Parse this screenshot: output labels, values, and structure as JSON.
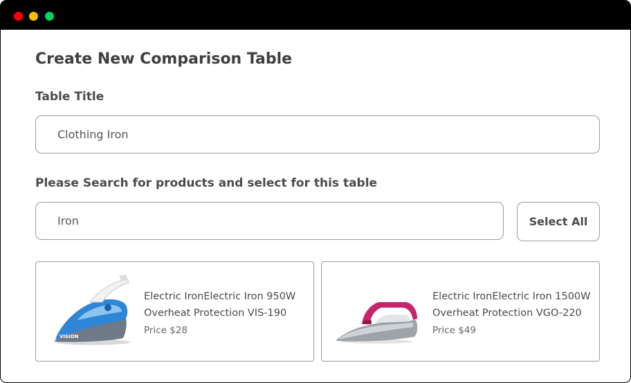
{
  "window": {
    "controls": [
      "close",
      "minimize",
      "maximize"
    ]
  },
  "page": {
    "heading": "Create New Comparison Table"
  },
  "table_title": {
    "label": "Table Title",
    "value": "Clothing Iron"
  },
  "search": {
    "label": "Please Search for products and select for this table",
    "value": "Iron"
  },
  "select_all_label": "Select All",
  "products": [
    {
      "name": "Electric IronElectric Iron 950W Overheat Protection VIS-190",
      "price": "Price $28",
      "image_icon": "blue-steam-iron"
    },
    {
      "name": "Electric IronElectric Iron 1500W Overheat Protection VGO-220",
      "price": "Price $49",
      "image_icon": "pink-dry-iron"
    }
  ],
  "colors": {
    "close": "#ff0000",
    "minimize": "#f4c000",
    "maximize": "#00d060",
    "iron_blue": "#2f86d6",
    "iron_pink": "#c8246a"
  }
}
